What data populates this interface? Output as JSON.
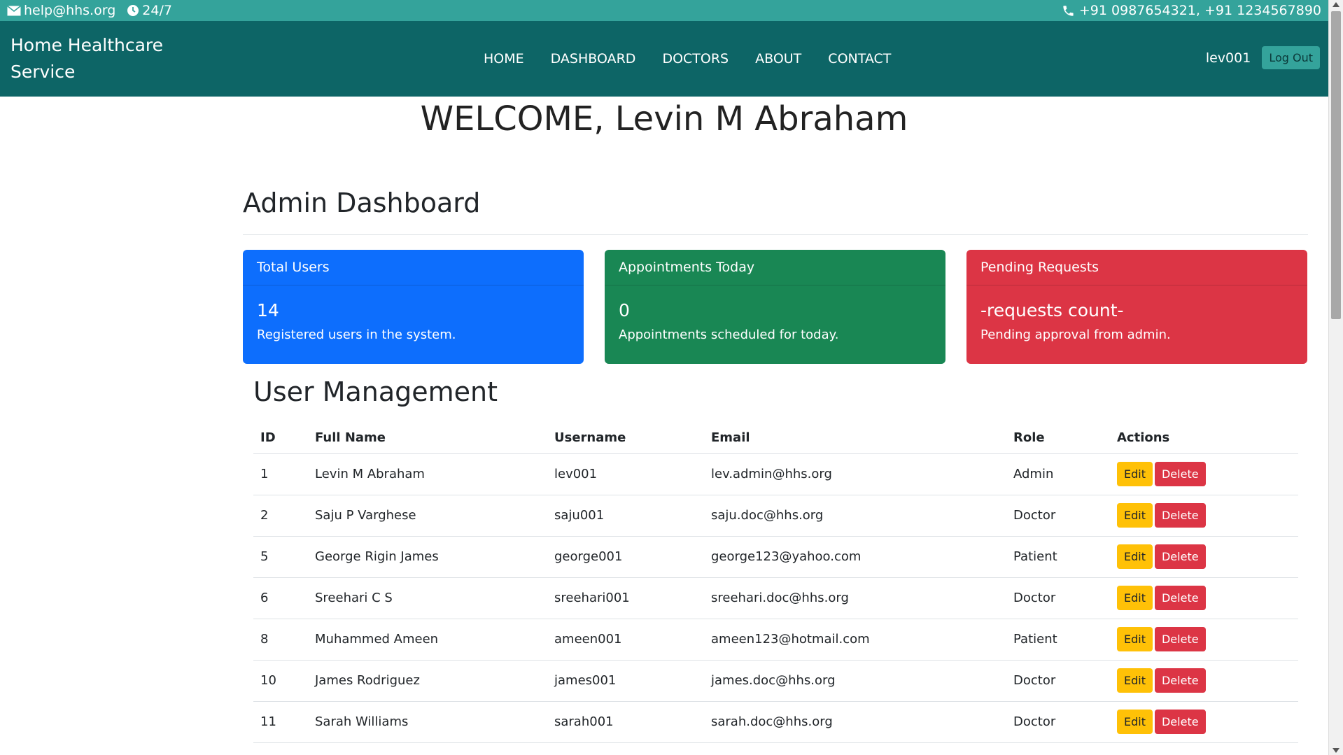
{
  "topbar": {
    "email": "help@hhs.org",
    "hours": "24/7",
    "phones": "+91 0987654321, +91 1234567890"
  },
  "navbar": {
    "brand": "Home Healthcare Service",
    "links": [
      "HOME",
      "DASHBOARD",
      "DOCTORS",
      "ABOUT",
      "CONTACT"
    ],
    "username": "lev001",
    "logout": "Log Out"
  },
  "welcome": "WELCOME, Levin M Abraham",
  "dashboard": {
    "title": "Admin Dashboard",
    "cards": [
      {
        "header": "Total Users",
        "value": "14",
        "desc": "Registered users in the system."
      },
      {
        "header": "Appointments Today",
        "value": "0",
        "desc": "Appointments scheduled for today."
      },
      {
        "header": "Pending Requests",
        "value": "-requests count-",
        "desc": "Pending approval from admin."
      }
    ],
    "colors": {
      "blue": "#0d6efd",
      "green": "#198754",
      "red": "#dc3545"
    }
  },
  "users": {
    "title": "User Management",
    "columns": [
      "ID",
      "Full Name",
      "Username",
      "Email",
      "Role",
      "Actions"
    ],
    "edit_label": "Edit",
    "delete_label": "Delete",
    "rows": [
      {
        "id": "1",
        "name": "Levin M Abraham",
        "username": "lev001",
        "email": "lev.admin@hhs.org",
        "role": "Admin"
      },
      {
        "id": "2",
        "name": "Saju P Varghese",
        "username": "saju001",
        "email": "saju.doc@hhs.org",
        "role": "Doctor"
      },
      {
        "id": "5",
        "name": "George Rigin James",
        "username": "george001",
        "email": "george123@yahoo.com",
        "role": "Patient"
      },
      {
        "id": "6",
        "name": "Sreehari C S",
        "username": "sreehari001",
        "email": "sreehari.doc@hhs.org",
        "role": "Doctor"
      },
      {
        "id": "8",
        "name": "Muhammed Ameen",
        "username": "ameen001",
        "email": "ameen123@hotmail.com",
        "role": "Patient"
      },
      {
        "id": "10",
        "name": "James Rodriguez",
        "username": "james001",
        "email": "james.doc@hhs.org",
        "role": "Doctor"
      },
      {
        "id": "11",
        "name": "Sarah Williams",
        "username": "sarah001",
        "email": "sarah.doc@hhs.org",
        "role": "Doctor"
      }
    ]
  }
}
